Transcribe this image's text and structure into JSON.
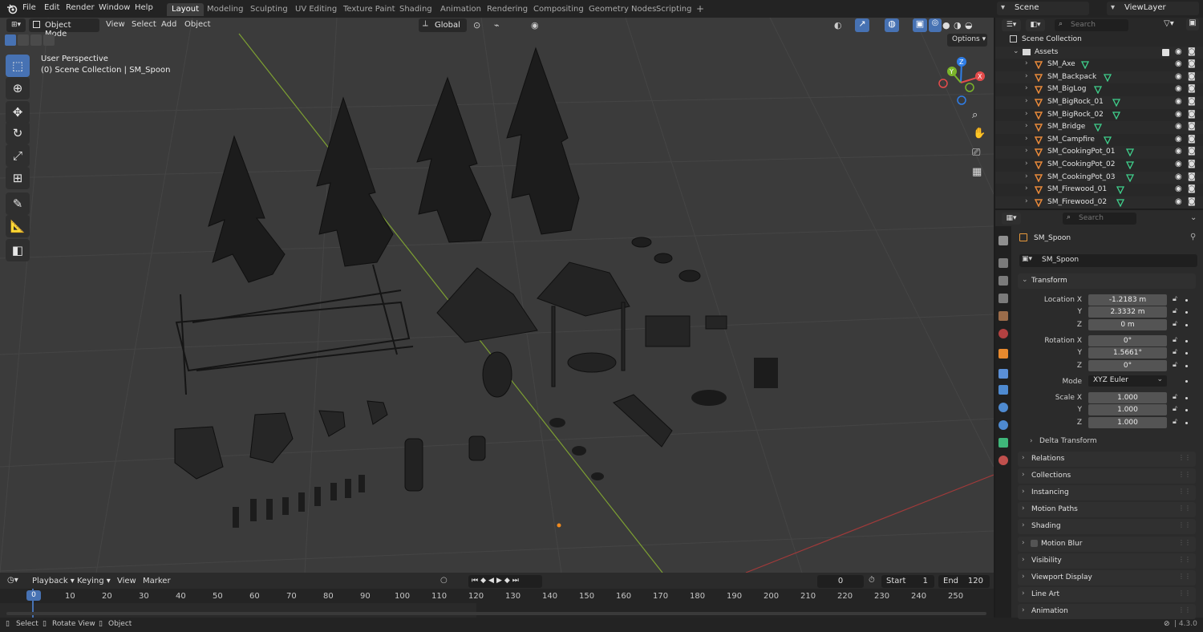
{
  "app": {
    "menus": [
      "File",
      "Edit",
      "Render",
      "Window",
      "Help"
    ],
    "workspaces": [
      "Layout",
      "Modeling",
      "Sculpting",
      "UV Editing",
      "Texture Paint",
      "Shading",
      "Animation",
      "Rendering",
      "Compositing",
      "Geometry Nodes",
      "Scripting"
    ],
    "add_workspace": "+",
    "scene": "Scene",
    "view_layer": "ViewLayer",
    "version": "4.3.0"
  },
  "viewport": {
    "mode": "Object Mode",
    "menus": [
      "View",
      "Select",
      "Add",
      "Object"
    ],
    "transform_orientation": "Global",
    "options_label": "Options",
    "overlay_line1": "User Perspective",
    "overlay_line2": "(0) Scene Collection | SM_Spoon",
    "gizmo_axes": [
      "X",
      "Y",
      "Z"
    ],
    "colors": {
      "background": "#3b3b3b",
      "grid": "#464646",
      "x_axis": "#a03a3a",
      "y_axis": "#7da032",
      "selected": "#4772b3"
    }
  },
  "timeline": {
    "menus": [
      "Playback",
      "Keying",
      "View",
      "Marker"
    ],
    "current_frame": "0",
    "start_label": "Start",
    "start_value": "1",
    "end_label": "End",
    "end_value": "120",
    "ruler": [
      "0",
      "10",
      "20",
      "30",
      "40",
      "50",
      "60",
      "70",
      "80",
      "90",
      "100",
      "110",
      "120",
      "130",
      "140",
      "150",
      "160",
      "170",
      "180",
      "190",
      "200",
      "210",
      "220",
      "230",
      "240",
      "250"
    ]
  },
  "status": {
    "select": "Select",
    "rotate": "Rotate View",
    "object": "Object"
  },
  "outliner": {
    "search_placeholder": "Search",
    "root": "Scene Collection",
    "collection": "Assets",
    "items": [
      "SM_Axe",
      "SM_Backpack",
      "SM_BigLog",
      "SM_BigRock_01",
      "SM_BigRock_02",
      "SM_Bridge",
      "SM_Campfire",
      "SM_CookingPot_01",
      "SM_CookingPot_02",
      "SM_CookingPot_03",
      "SM_Firewood_01",
      "SM_Firewood_02"
    ]
  },
  "properties": {
    "search_placeholder": "Search",
    "object_name": "SM_Spoon",
    "object_field": "SM_Spoon",
    "transform": {
      "title": "Transform",
      "location_label": "Location X",
      "location": [
        "-1.2183 m",
        "2.3332 m",
        "0 m"
      ],
      "rotation_label": "Rotation X",
      "rotation": [
        "0°",
        "1.5661°",
        "0°"
      ],
      "mode_label": "Mode",
      "mode_value": "XYZ Euler",
      "scale_label": "Scale X",
      "scale": [
        "1.000",
        "1.000",
        "1.000"
      ],
      "axis_y": "Y",
      "axis_z": "Z",
      "delta": "Delta Transform"
    },
    "panels": [
      "Relations",
      "Collections",
      "Instancing",
      "Motion Paths",
      "Shading",
      "Motion Blur",
      "Visibility",
      "Viewport Display",
      "Line Art",
      "Animation"
    ]
  }
}
